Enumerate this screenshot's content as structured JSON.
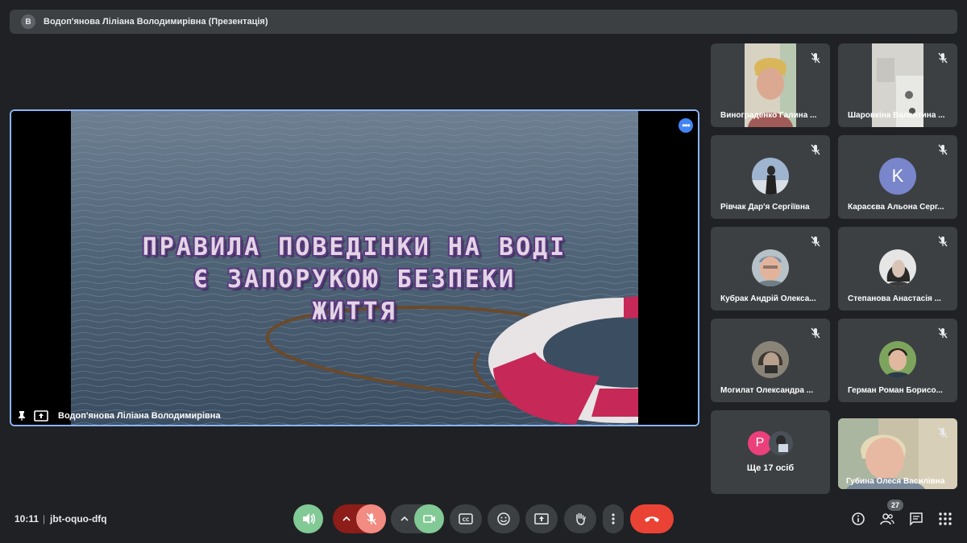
{
  "presentation_bar": {
    "avatar_letter": "В",
    "title": "Водоп'янова Ліліана Володимирівна (Презентація)"
  },
  "main_tile": {
    "presenter_label": "Водоп'янова Ліліана Володимирівна",
    "slide_text": [
      "ПРАВИЛА ПОВЕДІНКИ НА ВОДІ",
      "Є ЗАПОРУКОЮ БЕЗПЕКИ",
      "ЖИТТЯ"
    ],
    "more_icon": "more-horizontal-icon"
  },
  "participants": [
    {
      "name": "Винограденко Галина ...",
      "kind": "video"
    },
    {
      "name": "Шаровкіна Валентина ...",
      "kind": "video"
    },
    {
      "name": "Рівчак Дар'я Сергіївна",
      "kind": "photo"
    },
    {
      "name": "Карасєва Альона Серг...",
      "kind": "letter",
      "letter": "K",
      "color": "#7986cb"
    },
    {
      "name": "Кубрак Андрій Олекса...",
      "kind": "photo"
    },
    {
      "name": "Степанова Анастасія ...",
      "kind": "photo"
    },
    {
      "name": "Могилат Олександра ...",
      "kind": "photo"
    },
    {
      "name": "Герман Роман Борисо...",
      "kind": "photo"
    }
  ],
  "more_tile": {
    "label": "Ще 17 осіб",
    "avatar_letter": "Р",
    "avatar_color": "#ec407a"
  },
  "self_tile": {
    "name": "Губина Олеся Василівна"
  },
  "bottom": {
    "time": "10:11",
    "separator": "|",
    "meeting_code": "jbt-oquo-dfq",
    "participant_count": "27"
  },
  "colors": {
    "accent": "#8ab4f8",
    "green": "#81c995",
    "muted_red": "#f28b82",
    "end_red": "#ea4335"
  }
}
